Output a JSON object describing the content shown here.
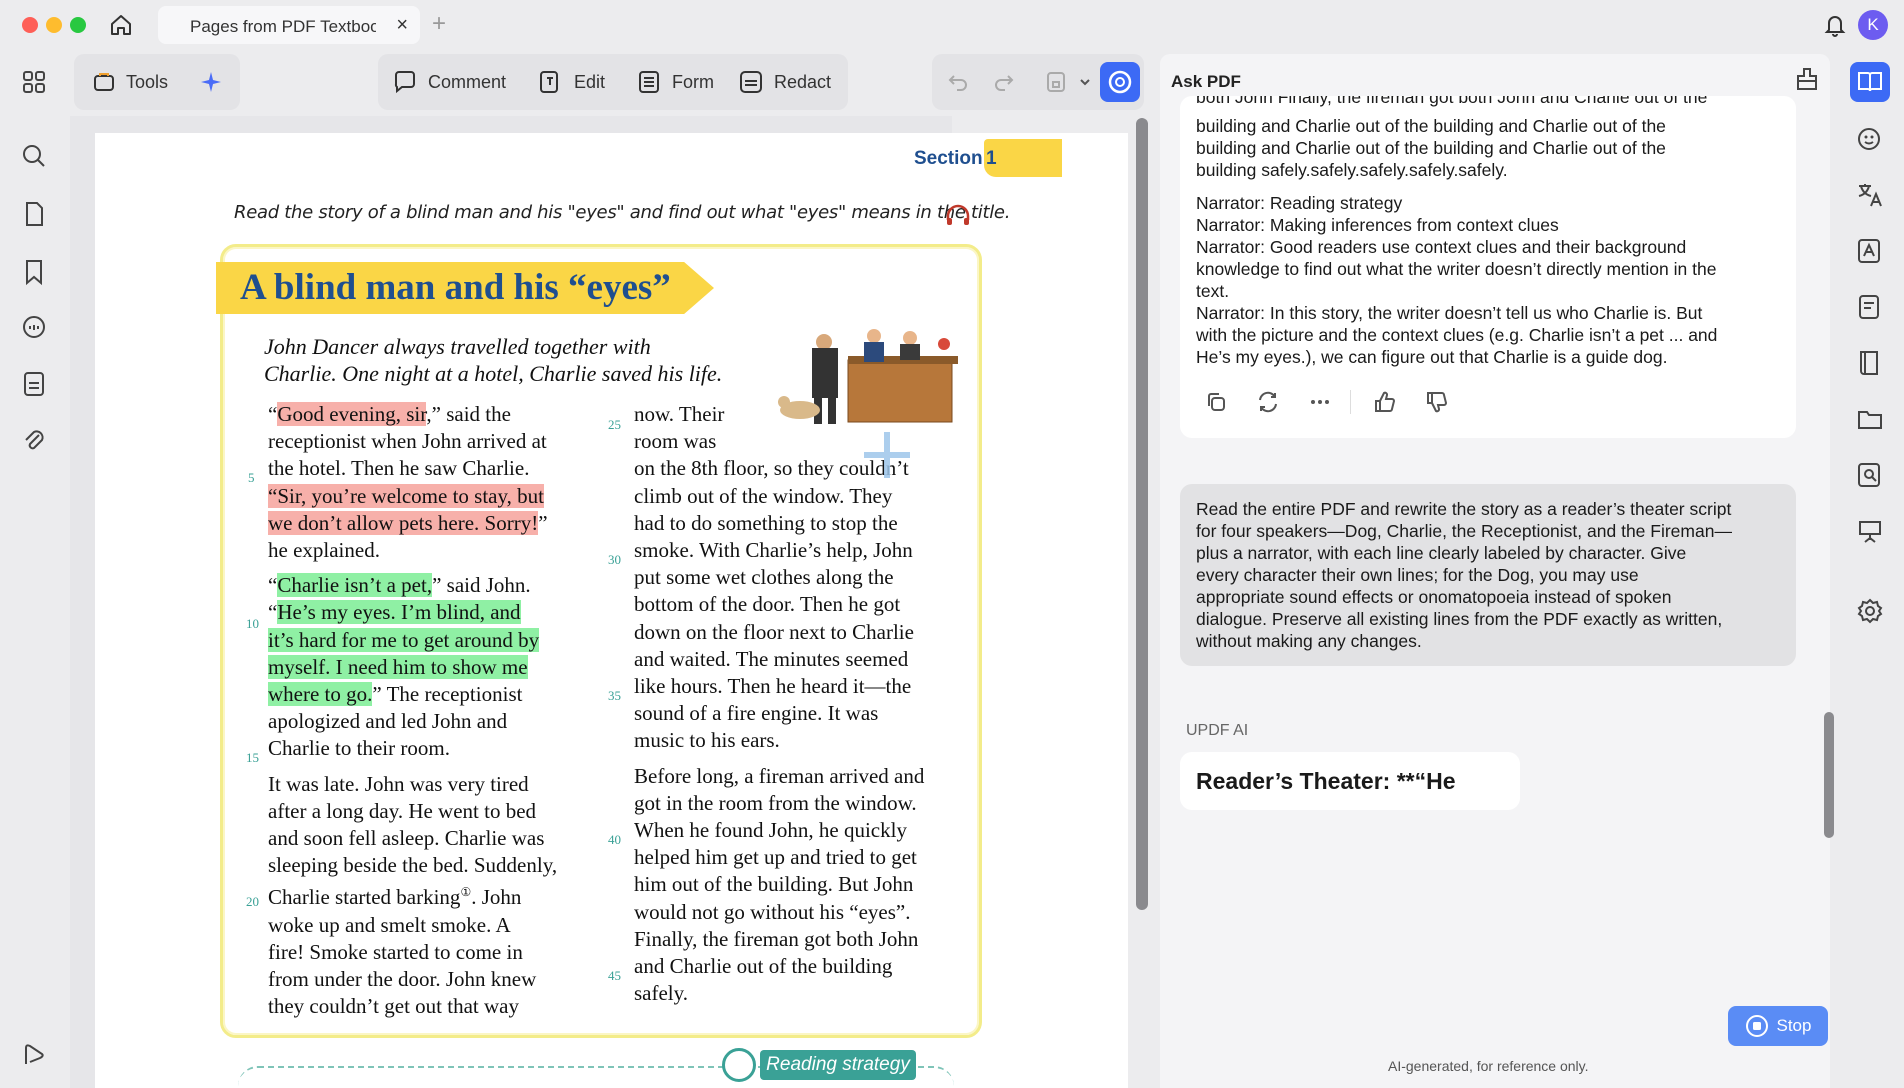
{
  "window": {
    "tab_title": "Pages from PDF Textbook",
    "tab_close": "×",
    "tab_add": "+",
    "avatar_letter": "K"
  },
  "toolbar": {
    "tools_label": "Tools",
    "comment_label": "Comment",
    "edit_label": "Edit",
    "form_label": "Form",
    "redact_label": "Redact"
  },
  "document": {
    "section_label": "Section",
    "section_number": "1",
    "intro": "Read the story of a blind man and his \"eyes\" and find out what \"eyes\" means in the title.",
    "story_title": "A blind man and his “eyes”",
    "summary_line1": "John Dancer always travelled together with",
    "summary_line2": "Charlie. One night at a hotel, Charlie saved his life.",
    "line_numbers": [
      "5",
      "10",
      "15",
      "20",
      "25",
      "30",
      "35",
      "40",
      "45"
    ],
    "col1": [
      {
        "pre": "“",
        "hl": "Good evening, sir",
        "hl_color": "pink",
        "post": ",” said the"
      },
      {
        "text": "receptionist when John arrived at"
      },
      {
        "text": "the hotel. Then he saw Charlie."
      },
      {
        "hl": "“Sir, you’re welcome to stay, but",
        "hl_color": "pink"
      },
      {
        "hl": "we don’t allow pets here. Sorry!",
        "hl_color": "pink",
        "post": "”"
      },
      {
        "text": "he explained."
      },
      {
        "gap": true
      },
      {
        "pre": "“",
        "hl": "Charlie isn’t a pet,",
        "hl_color": "green",
        "post": "” said John."
      },
      {
        "pre": "“",
        "hl": "He’s my eyes. I’m blind, and",
        "hl_color": "green"
      },
      {
        "hl": "it’s hard for me to get around by",
        "hl_color": "green"
      },
      {
        "hl": "myself. I need him to show me",
        "hl_color": "green"
      },
      {
        "hl": "where to go.",
        "hl_color": "green",
        "post": "” The receptionist"
      },
      {
        "text": "apologized and led John and"
      },
      {
        "text": "Charlie to their room."
      },
      {
        "gap": true
      },
      {
        "text": "It was late. John was very tired"
      },
      {
        "text": "after a long day. He went to bed"
      },
      {
        "text": "and soon fell asleep. Charlie was"
      },
      {
        "text": "sleeping beside the bed. Suddenly,"
      },
      {
        "text": "Charlie started barking",
        "sup": "①",
        "post": ". John"
      },
      {
        "text": "woke up and smelt smoke. A"
      },
      {
        "text": "fire! Smoke started to come in"
      },
      {
        "text": "from under the door. John knew"
      },
      {
        "text": "they couldn’t get out that way"
      }
    ],
    "col2": [
      "now. Their",
      "room was",
      "on the 8th floor, so they couldn’t",
      "climb out of the window. They",
      "had to do something to stop the",
      "smoke. With Charlie’s help, John",
      "put some wet clothes along the",
      "bottom of the door. Then he got",
      "down on the floor next to Charlie",
      "and waited. The minutes seemed",
      "like hours. Then he heard it—the",
      "sound of a fire engine. It was",
      "music to his ears.",
      "",
      "Before long, a fireman arrived and",
      "got in the room from the window.",
      "When he found John, he quickly",
      "helped him get up and tried to get",
      "him out of the building. But John",
      "would not go without his “eyes”.",
      "Finally, the fireman got both John",
      "and Charlie out of the building",
      "safely."
    ],
    "reading_strategy_tag": "Reading strategy"
  },
  "ai": {
    "title": "Ask PDF",
    "top_fragment": "both John Finally, the fireman got both John and Charlie out of the",
    "response_lines_a": [
      "building and Charlie out of the building and Charlie out of the",
      "building and Charlie out of the building and Charlie out of the",
      "building safely.safely.safely.safely.safely."
    ],
    "response_lines_b": [
      "Narrator: Reading strategy",
      "Narrator: Making inferences from context clues",
      "Narrator: Good readers use context clues and their background",
      "knowledge to find out what the writer doesn’t directly mention in the",
      "text.",
      "Narrator: In this story, the writer doesn’t tell us who Charlie is. But",
      "with the picture and the context clues (e.g. Charlie isn’t a pet ... and",
      "He’s my eyes.), we can figure out that Charlie is a guide dog."
    ],
    "user_message_lines": [
      "Read the entire PDF and rewrite the story as a reader’s theater script",
      "for four speakers—Dog, Charlie, the Receptionist, and the Fireman—",
      "plus a narrator, with each line clearly labeled by character. Give",
      "every character their own lines; for the Dog, you may use",
      "appropriate sound effects or onomatopoeia instead of spoken",
      "dialogue. Preserve all existing lines from the PDF exactly as written,",
      "without making any changes."
    ],
    "assistant_label": "UPDF AI",
    "streaming_text": "Reader’s Theater: **“He",
    "stop_label": "Stop",
    "footnote": "AI-generated, for reference only."
  }
}
